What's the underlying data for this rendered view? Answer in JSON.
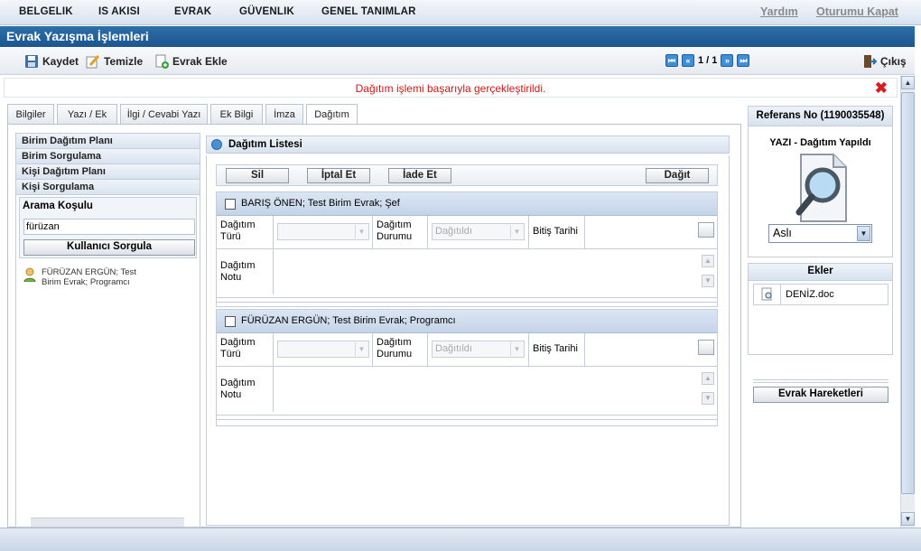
{
  "nav": {
    "menu": [
      "BELGELIK",
      "IS AKISI",
      "EVRAK",
      "GÜVENLIK",
      "GENEL TANIMLAR"
    ],
    "help": "Yardım",
    "logout": "Oturumu Kapat"
  },
  "window": {
    "title": "Evrak Yazışma İşlemleri"
  },
  "toolbar": {
    "save": "Kaydet",
    "clear": "Temizle",
    "add_doc": "Evrak Ekle",
    "page": "1 / 1",
    "exit": "Çıkış"
  },
  "message": "Dağıtım işlemi başarıyla gerçekleştirildi.",
  "tabs": [
    "Bilgiler",
    "Yazı / Ek",
    "İlgi / Cevabi Yazı",
    "Ek Bilgi",
    "İmza",
    "Dağıtım"
  ],
  "left": {
    "items": [
      "Birim Dağıtım Planı",
      "Birim Sorgulama",
      "Kişi Dağıtım Planı",
      "Kişi Sorgulama"
    ],
    "search_label": "Arama Koşulu",
    "search_value": "fürüzan",
    "search_button": "Kullanıcı Sorgula",
    "result_line1": "FÜRÜZAN ERGÜN; Test",
    "result_line2": "Birim Evrak; Programcı"
  },
  "distribution": {
    "title": "Dağıtım Listesi",
    "buttons": {
      "delete": "Sil",
      "cancel": "İptal Et",
      "return": "İade Et",
      "distribute": "Dağıt"
    },
    "labels": {
      "type": "Dağıtım Türü",
      "status": "Dağıtım Durumu",
      "end_date": "Bitiş Tarihi",
      "note": "Dağıtım Notu"
    },
    "recipients": [
      {
        "name": "BARIŞ ÖNEN; Test Birim Evrak; Şef",
        "type": "",
        "status": "Dağıtıldı"
      },
      {
        "name": "FÜRÜZAN ERGÜN; Test Birim Evrak; Programcı",
        "type": "",
        "status": "Dağıtıldı"
      }
    ]
  },
  "reference": {
    "title": "Referans No (1190035548)",
    "status": "YAZI - Dağıtım Yapıldı",
    "copy_type": "Aslı"
  },
  "attachments": {
    "title": "Ekler",
    "files": [
      "DENİZ.doc"
    ]
  },
  "history_button": "Evrak Hareketleri",
  "colors": {
    "title_bar": "#1c5590",
    "message": "#c81818",
    "panel_header": "#d7e2ef"
  }
}
